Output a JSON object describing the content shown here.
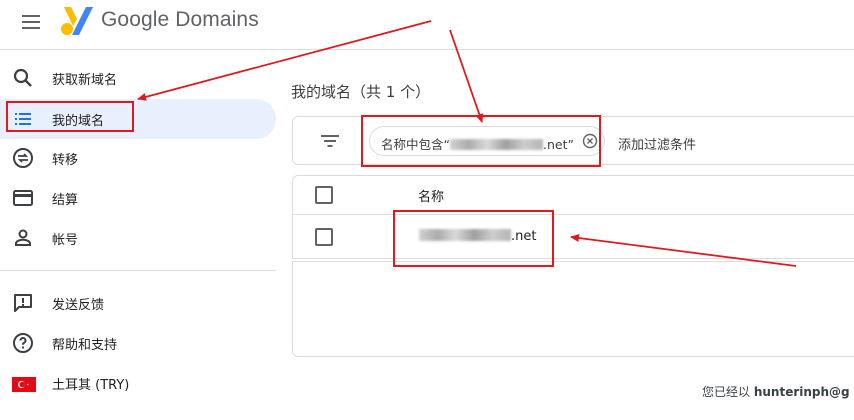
{
  "header": {
    "brand": "Google Domains"
  },
  "sidebar": {
    "items": [
      {
        "label": "获取新域名",
        "icon": "search-icon"
      },
      {
        "label": "我的域名",
        "icon": "list-icon"
      },
      {
        "label": "转移",
        "icon": "transfer-icon"
      },
      {
        "label": "结算",
        "icon": "credit-card-icon"
      },
      {
        "label": "帐号",
        "icon": "person-icon"
      }
    ],
    "support": [
      {
        "label": "发送反馈",
        "icon": "feedback-icon"
      },
      {
        "label": "帮助和支持",
        "icon": "help-icon"
      },
      {
        "label": "土耳其 (TRY)",
        "icon": "turkey-flag-icon"
      }
    ],
    "active_index": 1
  },
  "main": {
    "title": "我的域名（共 1 个）",
    "filter": {
      "chip_prefix": "名称中包含“",
      "chip_suffix": ".net”",
      "add_filter": "添加过滤条件"
    },
    "table": {
      "column_header": "名称",
      "rows": [
        {
          "domain_suffix": ".net"
        }
      ]
    }
  },
  "footer": {
    "signed_in_prefix": "您已经以 ",
    "account": "hunterinph@g"
  },
  "colors": {
    "annotation": "#e0191f",
    "active_bg": "#e8f0fe",
    "accent": "#1a73e8"
  }
}
